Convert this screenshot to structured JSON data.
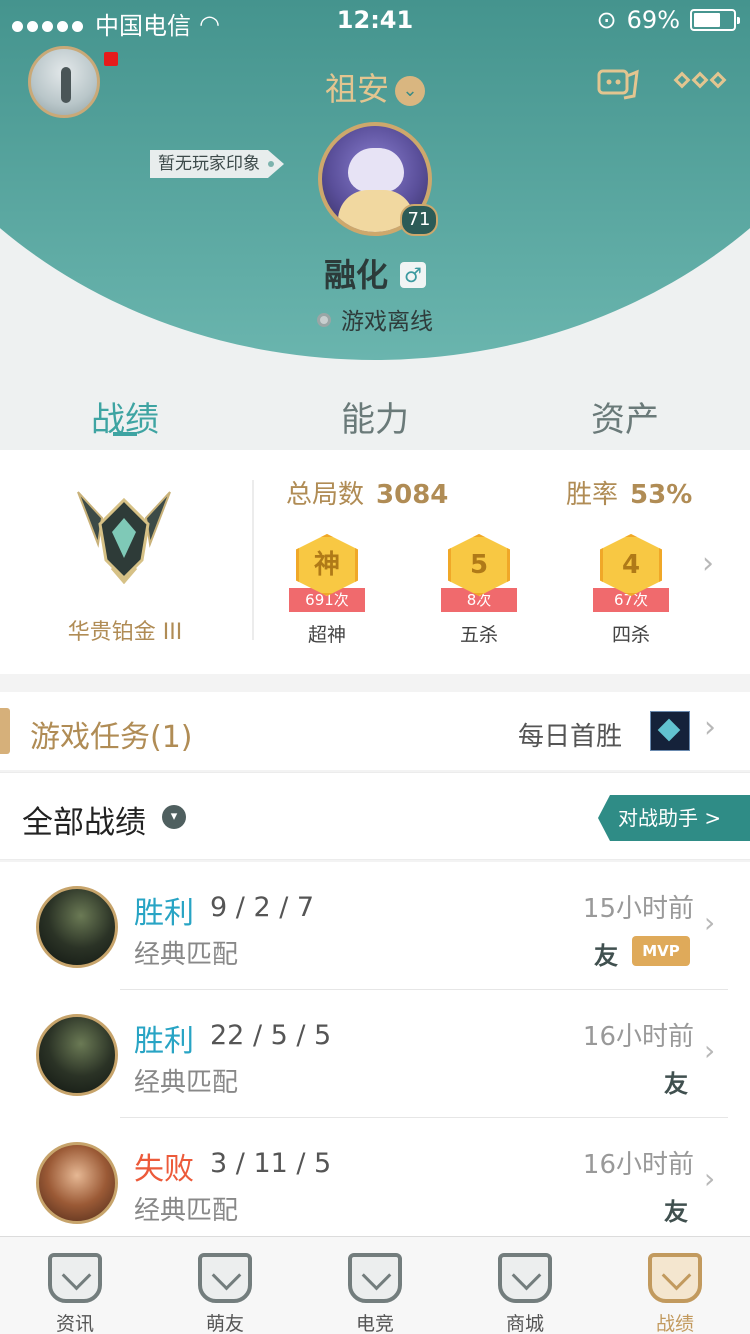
{
  "status_bar": {
    "carrier": "中国电信",
    "time": "12:41",
    "battery": "69%",
    "battery_level": 0.69
  },
  "header": {
    "server": "祖安",
    "impression": "暂无玩家印象",
    "level": "71",
    "nickname": "融化",
    "gender_symbol": "♂",
    "online_status": "游戏离线"
  },
  "tabs": [
    {
      "label": "战绩"
    },
    {
      "label": "能力"
    },
    {
      "label": "资产"
    }
  ],
  "stats": {
    "rank": "华贵铂金 III",
    "total_label": "总局数",
    "total_value": "3084",
    "winrate_label": "胜率",
    "winrate_value": "53%",
    "medals": [
      {
        "glyph": "神",
        "count": "691次",
        "label": "超神"
      },
      {
        "glyph": "5",
        "count": "8次",
        "label": "五杀"
      },
      {
        "glyph": "4",
        "count": "67次",
        "label": "四杀"
      }
    ]
  },
  "task": {
    "title": "游戏任务(1)",
    "daily": "每日首胜"
  },
  "records": {
    "title": "全部战绩",
    "assistant": "对战助手 >"
  },
  "matches": [
    {
      "result": "胜利",
      "kda": "9 / 2 / 7",
      "mode": "经典匹配",
      "time": "15小时前",
      "friend": "友",
      "mvp": "MVP"
    },
    {
      "result": "胜利",
      "kda": "22 / 5 / 5",
      "mode": "经典匹配",
      "time": "16小时前",
      "friend": "友"
    },
    {
      "result": "失败",
      "kda": "3 / 11 / 5",
      "mode": "经典匹配",
      "time": "16小时前",
      "friend": "友"
    }
  ],
  "bottom_nav": [
    {
      "label": "资讯"
    },
    {
      "label": "萌友"
    },
    {
      "label": "电竞"
    },
    {
      "label": "商城"
    },
    {
      "label": "战绩"
    }
  ],
  "colors": {
    "teal": "#2c7f7a",
    "gold": "#b08c55",
    "win": "#28a4c4",
    "lose": "#ec5a3a"
  }
}
